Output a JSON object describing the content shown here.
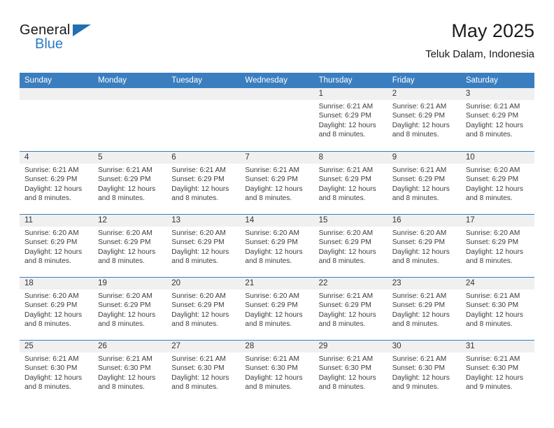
{
  "logo": {
    "word1": "General",
    "word2": "Blue",
    "triangle_color": "#1f6fb2",
    "blue_text_color": "#2b7cc4"
  },
  "header": {
    "title": "May 2025",
    "subtitle": "Teluk Dalam, Indonesia"
  },
  "theme": {
    "header_row_bg": "#3a7ebf",
    "daynum_band_bg": "#f0f0f0",
    "grid_line": "#3a7ebf",
    "text": "#3d3d3d"
  },
  "weekday_headers": [
    "Sunday",
    "Monday",
    "Tuesday",
    "Wednesday",
    "Thursday",
    "Friday",
    "Saturday"
  ],
  "labels": {
    "sunrise_prefix": "Sunrise:",
    "sunset_prefix": "Sunset:",
    "daylight_prefix": "Daylight:"
  },
  "weeks": [
    [
      {
        "day": "",
        "empty": true
      },
      {
        "day": "",
        "empty": true
      },
      {
        "day": "",
        "empty": true
      },
      {
        "day": "",
        "empty": true
      },
      {
        "day": "1",
        "sunrise": "Sunrise: 6:21 AM",
        "sunset": "Sunset: 6:29 PM",
        "daylight1": "Daylight: 12 hours",
        "daylight2": "and 8 minutes."
      },
      {
        "day": "2",
        "sunrise": "Sunrise: 6:21 AM",
        "sunset": "Sunset: 6:29 PM",
        "daylight1": "Daylight: 12 hours",
        "daylight2": "and 8 minutes."
      },
      {
        "day": "3",
        "sunrise": "Sunrise: 6:21 AM",
        "sunset": "Sunset: 6:29 PM",
        "daylight1": "Daylight: 12 hours",
        "daylight2": "and 8 minutes."
      }
    ],
    [
      {
        "day": "4",
        "sunrise": "Sunrise: 6:21 AM",
        "sunset": "Sunset: 6:29 PM",
        "daylight1": "Daylight: 12 hours",
        "daylight2": "and 8 minutes."
      },
      {
        "day": "5",
        "sunrise": "Sunrise: 6:21 AM",
        "sunset": "Sunset: 6:29 PM",
        "daylight1": "Daylight: 12 hours",
        "daylight2": "and 8 minutes."
      },
      {
        "day": "6",
        "sunrise": "Sunrise: 6:21 AM",
        "sunset": "Sunset: 6:29 PM",
        "daylight1": "Daylight: 12 hours",
        "daylight2": "and 8 minutes."
      },
      {
        "day": "7",
        "sunrise": "Sunrise: 6:21 AM",
        "sunset": "Sunset: 6:29 PM",
        "daylight1": "Daylight: 12 hours",
        "daylight2": "and 8 minutes."
      },
      {
        "day": "8",
        "sunrise": "Sunrise: 6:21 AM",
        "sunset": "Sunset: 6:29 PM",
        "daylight1": "Daylight: 12 hours",
        "daylight2": "and 8 minutes."
      },
      {
        "day": "9",
        "sunrise": "Sunrise: 6:21 AM",
        "sunset": "Sunset: 6:29 PM",
        "daylight1": "Daylight: 12 hours",
        "daylight2": "and 8 minutes."
      },
      {
        "day": "10",
        "sunrise": "Sunrise: 6:20 AM",
        "sunset": "Sunset: 6:29 PM",
        "daylight1": "Daylight: 12 hours",
        "daylight2": "and 8 minutes."
      }
    ],
    [
      {
        "day": "11",
        "sunrise": "Sunrise: 6:20 AM",
        "sunset": "Sunset: 6:29 PM",
        "daylight1": "Daylight: 12 hours",
        "daylight2": "and 8 minutes."
      },
      {
        "day": "12",
        "sunrise": "Sunrise: 6:20 AM",
        "sunset": "Sunset: 6:29 PM",
        "daylight1": "Daylight: 12 hours",
        "daylight2": "and 8 minutes."
      },
      {
        "day": "13",
        "sunrise": "Sunrise: 6:20 AM",
        "sunset": "Sunset: 6:29 PM",
        "daylight1": "Daylight: 12 hours",
        "daylight2": "and 8 minutes."
      },
      {
        "day": "14",
        "sunrise": "Sunrise: 6:20 AM",
        "sunset": "Sunset: 6:29 PM",
        "daylight1": "Daylight: 12 hours",
        "daylight2": "and 8 minutes."
      },
      {
        "day": "15",
        "sunrise": "Sunrise: 6:20 AM",
        "sunset": "Sunset: 6:29 PM",
        "daylight1": "Daylight: 12 hours",
        "daylight2": "and 8 minutes."
      },
      {
        "day": "16",
        "sunrise": "Sunrise: 6:20 AM",
        "sunset": "Sunset: 6:29 PM",
        "daylight1": "Daylight: 12 hours",
        "daylight2": "and 8 minutes."
      },
      {
        "day": "17",
        "sunrise": "Sunrise: 6:20 AM",
        "sunset": "Sunset: 6:29 PM",
        "daylight1": "Daylight: 12 hours",
        "daylight2": "and 8 minutes."
      }
    ],
    [
      {
        "day": "18",
        "sunrise": "Sunrise: 6:20 AM",
        "sunset": "Sunset: 6:29 PM",
        "daylight1": "Daylight: 12 hours",
        "daylight2": "and 8 minutes."
      },
      {
        "day": "19",
        "sunrise": "Sunrise: 6:20 AM",
        "sunset": "Sunset: 6:29 PM",
        "daylight1": "Daylight: 12 hours",
        "daylight2": "and 8 minutes."
      },
      {
        "day": "20",
        "sunrise": "Sunrise: 6:20 AM",
        "sunset": "Sunset: 6:29 PM",
        "daylight1": "Daylight: 12 hours",
        "daylight2": "and 8 minutes."
      },
      {
        "day": "21",
        "sunrise": "Sunrise: 6:20 AM",
        "sunset": "Sunset: 6:29 PM",
        "daylight1": "Daylight: 12 hours",
        "daylight2": "and 8 minutes."
      },
      {
        "day": "22",
        "sunrise": "Sunrise: 6:21 AM",
        "sunset": "Sunset: 6:29 PM",
        "daylight1": "Daylight: 12 hours",
        "daylight2": "and 8 minutes."
      },
      {
        "day": "23",
        "sunrise": "Sunrise: 6:21 AM",
        "sunset": "Sunset: 6:29 PM",
        "daylight1": "Daylight: 12 hours",
        "daylight2": "and 8 minutes."
      },
      {
        "day": "24",
        "sunrise": "Sunrise: 6:21 AM",
        "sunset": "Sunset: 6:30 PM",
        "daylight1": "Daylight: 12 hours",
        "daylight2": "and 8 minutes."
      }
    ],
    [
      {
        "day": "25",
        "sunrise": "Sunrise: 6:21 AM",
        "sunset": "Sunset: 6:30 PM",
        "daylight1": "Daylight: 12 hours",
        "daylight2": "and 8 minutes."
      },
      {
        "day": "26",
        "sunrise": "Sunrise: 6:21 AM",
        "sunset": "Sunset: 6:30 PM",
        "daylight1": "Daylight: 12 hours",
        "daylight2": "and 8 minutes."
      },
      {
        "day": "27",
        "sunrise": "Sunrise: 6:21 AM",
        "sunset": "Sunset: 6:30 PM",
        "daylight1": "Daylight: 12 hours",
        "daylight2": "and 8 minutes."
      },
      {
        "day": "28",
        "sunrise": "Sunrise: 6:21 AM",
        "sunset": "Sunset: 6:30 PM",
        "daylight1": "Daylight: 12 hours",
        "daylight2": "and 8 minutes."
      },
      {
        "day": "29",
        "sunrise": "Sunrise: 6:21 AM",
        "sunset": "Sunset: 6:30 PM",
        "daylight1": "Daylight: 12 hours",
        "daylight2": "and 8 minutes."
      },
      {
        "day": "30",
        "sunrise": "Sunrise: 6:21 AM",
        "sunset": "Sunset: 6:30 PM",
        "daylight1": "Daylight: 12 hours",
        "daylight2": "and 9 minutes."
      },
      {
        "day": "31",
        "sunrise": "Sunrise: 6:21 AM",
        "sunset": "Sunset: 6:30 PM",
        "daylight1": "Daylight: 12 hours",
        "daylight2": "and 9 minutes."
      }
    ]
  ]
}
